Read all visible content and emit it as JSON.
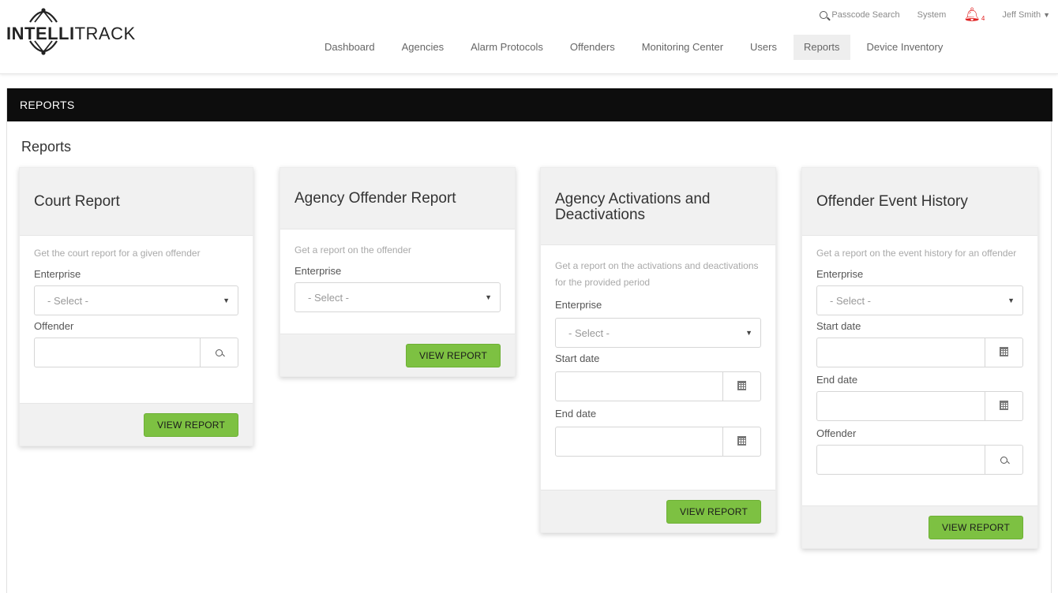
{
  "brand": {
    "logo_bold": "INTELLI",
    "logo_light": "TRACK"
  },
  "utility": {
    "passcode_search": "Passcode Search",
    "system": "System",
    "notification_count": "4",
    "user_name": "Jeff Smith"
  },
  "nav": {
    "items": [
      "Dashboard",
      "Agencies",
      "Alarm Protocols",
      "Offenders",
      "Monitoring Center",
      "Users",
      "Reports",
      "Device Inventory"
    ],
    "active": "Reports"
  },
  "titlebar": "REPORTS",
  "page_heading": "Reports",
  "cards": [
    {
      "title": "Court Report",
      "description": "Get the court report for a given offender",
      "enterprise_label": "Enterprise",
      "select_placeholder": "- Select -",
      "offender_label": "Offender",
      "button": "VIEW REPORT"
    },
    {
      "title": "Agency Offender Report",
      "description": "Get a report on the offender",
      "enterprise_label": "Enterprise",
      "select_placeholder": "- Select -",
      "button": "VIEW REPORT"
    },
    {
      "title": "Agency Activations and Deactivations",
      "description": "Get a report on the activations and deactivations for the provided period",
      "enterprise_label": "Enterprise",
      "select_placeholder": "- Select -",
      "start_label": "Start date",
      "end_label": "End date",
      "button": "VIEW REPORT"
    },
    {
      "title": "Offender Event History",
      "description": "Get a report on the event history for an offender",
      "enterprise_label": "Enterprise",
      "select_placeholder": "- Select -",
      "start_label": "Start date",
      "end_label": "End date",
      "offender_label": "Offender",
      "button": "VIEW REPORT"
    }
  ],
  "icons": {
    "search": "search-icon",
    "bell": "bell-icon",
    "calendar": "calendar-icon",
    "caret": "chevron-down-icon"
  },
  "colors": {
    "accent_button": "#7dc142",
    "titlebar_bg": "#0d0d0d",
    "notification": "#e02020",
    "card_header_bg": "#f1f1f1"
  }
}
